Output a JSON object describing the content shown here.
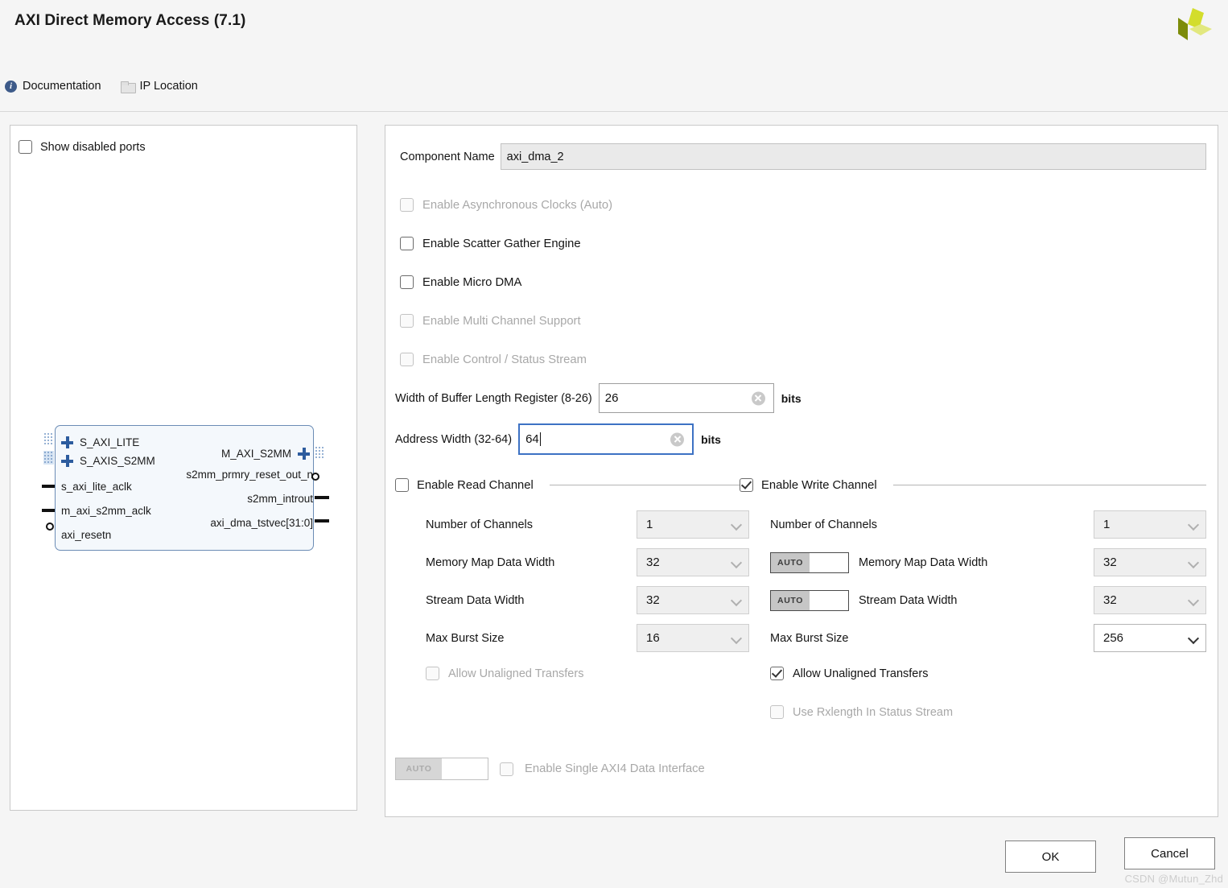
{
  "window": {
    "title": "AXI Direct Memory Access (7.1)",
    "logo_colors": [
      "#d3dd2c",
      "#7d8c0a",
      "#e2e87f"
    ]
  },
  "linkbar": {
    "documentation": "Documentation",
    "ip_location": "IP Location"
  },
  "left_panel": {
    "show_disabled_ports": {
      "label": "Show disabled ports",
      "checked": false
    },
    "diagram": {
      "left_buses": [
        "S_AXI_LITE",
        "S_AXIS_S2MM"
      ],
      "left_pins": [
        "s_axi_lite_aclk",
        "m_axi_s2mm_aclk",
        "axi_resetn"
      ],
      "right_buses": [
        "M_AXI_S2MM"
      ],
      "right_pins": [
        "s2mm_prmry_reset_out_n",
        "s2mm_introut",
        "axi_dma_tstvec[31:0]"
      ]
    }
  },
  "right_panel": {
    "component_name": {
      "label": "Component Name",
      "value": "axi_dma_2"
    },
    "options": [
      {
        "label": "Enable Asynchronous Clocks (Auto)",
        "checked": false,
        "enabled": false
      },
      {
        "label": "Enable Scatter Gather Engine",
        "checked": false,
        "enabled": true
      },
      {
        "label": "Enable Micro DMA",
        "checked": false,
        "enabled": true
      },
      {
        "label": "Enable Multi Channel Support",
        "checked": false,
        "enabled": false
      },
      {
        "label": "Enable Control / Status Stream",
        "checked": false,
        "enabled": false
      }
    ],
    "buffer_length": {
      "label": "Width of Buffer Length Register (8-26)",
      "value": "26",
      "units": "bits",
      "focused": false
    },
    "address_width": {
      "label": "Address Width (32-64)",
      "value": "64",
      "units": "bits",
      "focused": true
    },
    "read_channel": {
      "title": "Enable Read Channel",
      "checked": false,
      "rows": [
        {
          "label": "Number of Channels",
          "value": "1",
          "enabled": false,
          "auto": false
        },
        {
          "label": "Memory Map Data Width",
          "value": "32",
          "enabled": false,
          "auto": false
        },
        {
          "label": "Stream Data Width",
          "value": "32",
          "enabled": false,
          "auto": false
        },
        {
          "label": "Max Burst Size",
          "value": "16",
          "enabled": false,
          "auto": false
        }
      ],
      "unaligned": {
        "label": "Allow Unaligned Transfers",
        "checked": false,
        "enabled": false
      }
    },
    "write_channel": {
      "title": "Enable Write Channel",
      "checked": true,
      "rows": [
        {
          "label": "Number of Channels",
          "value": "1",
          "enabled": false,
          "auto": false
        },
        {
          "label": "Memory Map Data Width",
          "value": "32",
          "enabled": false,
          "auto": true,
          "auto_label": "AUTO"
        },
        {
          "label": "Stream Data Width",
          "value": "32",
          "enabled": false,
          "auto": true,
          "auto_label": "AUTO"
        },
        {
          "label": "Max Burst Size",
          "value": "256",
          "enabled": true,
          "auto": false
        }
      ],
      "unaligned": {
        "label": "Allow Unaligned Transfers",
        "checked": true,
        "enabled": true
      },
      "rxlength": {
        "label": "Use Rxlength In Status Stream",
        "checked": false,
        "enabled": false
      }
    },
    "single_axi4": {
      "auto_label": "AUTO",
      "label": "Enable Single AXI4 Data Interface",
      "checked": false,
      "enabled": false
    }
  },
  "footer": {
    "ok": "OK",
    "cancel": "Cancel",
    "watermark": "CSDN @Mutun_Zhd"
  }
}
